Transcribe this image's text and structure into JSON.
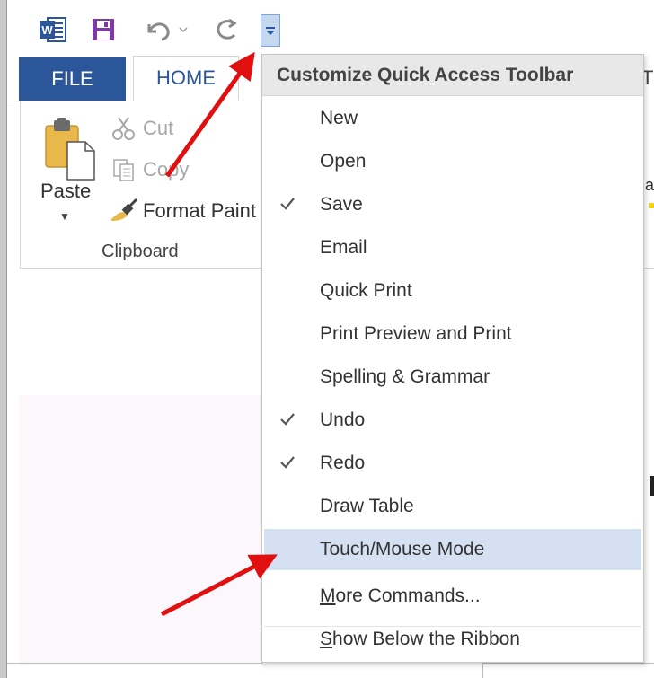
{
  "tabs": {
    "file": "FILE",
    "home": "HOME",
    "partial_next": "T"
  },
  "clipboard": {
    "paste": "Paste",
    "cut": "Cut",
    "copy": "Copy",
    "format_painter": "Format Paint",
    "group_label": "Clipboard"
  },
  "ribbon_partial": {
    "text": "a"
  },
  "menu": {
    "title": "Customize Quick Access Toolbar",
    "items": [
      {
        "label": "New",
        "checked": false
      },
      {
        "label": "Open",
        "checked": false
      },
      {
        "label": "Save",
        "checked": true
      },
      {
        "label": "Email",
        "checked": false
      },
      {
        "label": "Quick Print",
        "checked": false
      },
      {
        "label": "Print Preview and Print",
        "checked": false
      },
      {
        "label": "Spelling & Grammar",
        "checked": false
      },
      {
        "label": "Undo",
        "checked": true
      },
      {
        "label": "Redo",
        "checked": true
      },
      {
        "label": "Draw Table",
        "checked": false
      },
      {
        "label": "Touch/Mouse Mode",
        "checked": false,
        "hovered": true
      }
    ],
    "more_commands": {
      "underline": "M",
      "rest": "ore Commands..."
    },
    "show_below": {
      "underline": "S",
      "rest": "how Below the Ribbon"
    }
  },
  "icons": {
    "word": "word-app-icon",
    "save": "save-icon",
    "undo": "undo-icon",
    "redo": "redo-icon",
    "customize": "customize-dropdown-icon",
    "check": "checkmark-icon"
  },
  "colors": {
    "word_blue": "#2b579a",
    "save_purple": "#7e3aa4",
    "hover_blue": "#d5e1f2",
    "arrow_red": "#e01010"
  }
}
